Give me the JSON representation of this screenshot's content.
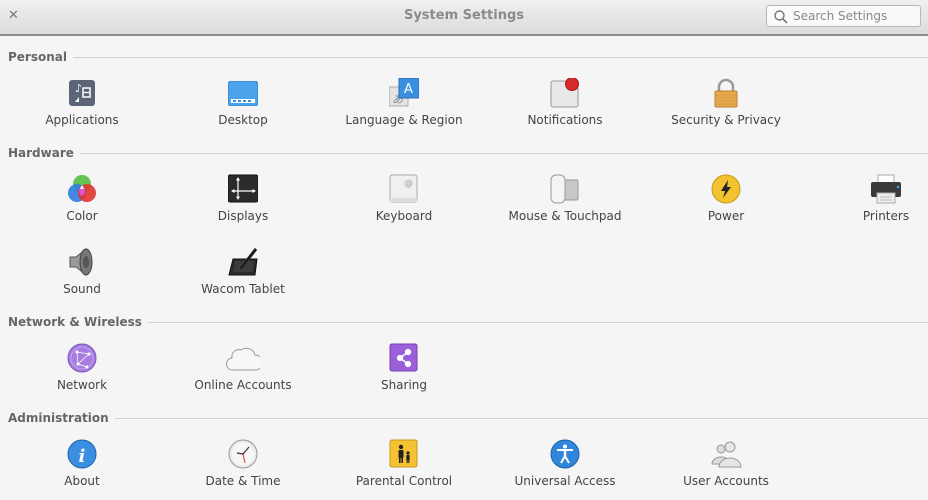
{
  "window": {
    "title": "System Settings",
    "close_icon": "close-icon",
    "search": {
      "placeholder": "Search Settings",
      "value": "",
      "icon": "search-icon"
    }
  },
  "sections": [
    {
      "title": "Personal",
      "items": [
        {
          "label": "Applications",
          "icon": "applications-icon"
        },
        {
          "label": "Desktop",
          "icon": "desktop-icon"
        },
        {
          "label": "Language & Region",
          "icon": "language-icon"
        },
        {
          "label": "Notifications",
          "icon": "notifications-icon"
        },
        {
          "label": "Security & Privacy",
          "icon": "lock-icon"
        }
      ]
    },
    {
      "title": "Hardware",
      "items": [
        {
          "label": "Color",
          "icon": "color-icon"
        },
        {
          "label": "Displays",
          "icon": "displays-icon"
        },
        {
          "label": "Keyboard",
          "icon": "keyboard-icon"
        },
        {
          "label": "Mouse & Touchpad",
          "icon": "mouse-icon"
        },
        {
          "label": "Power",
          "icon": "power-icon"
        },
        {
          "label": "Printers",
          "icon": "printer-icon"
        },
        {
          "label": "Sound",
          "icon": "speaker-icon"
        },
        {
          "label": "Wacom Tablet",
          "icon": "tablet-icon"
        }
      ]
    },
    {
      "title": "Network & Wireless",
      "items": [
        {
          "label": "Network",
          "icon": "network-icon"
        },
        {
          "label": "Online Accounts",
          "icon": "cloud-icon"
        },
        {
          "label": "Sharing",
          "icon": "share-icon"
        }
      ]
    },
    {
      "title": "Administration",
      "items": [
        {
          "label": "About",
          "icon": "info-icon"
        },
        {
          "label": "Date & Time",
          "icon": "clock-icon"
        },
        {
          "label": "Parental Control",
          "icon": "parental-icon"
        },
        {
          "label": "Universal Access",
          "icon": "accessibility-icon"
        },
        {
          "label": "User Accounts",
          "icon": "users-icon"
        }
      ]
    }
  ]
}
